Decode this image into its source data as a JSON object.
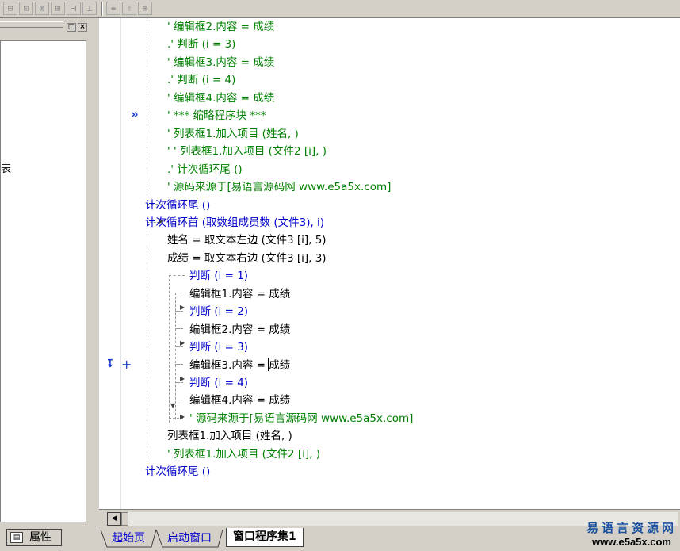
{
  "toolbar": {
    "buttons": [
      "align-left-icon",
      "align-center-icon",
      "align-top-icon",
      "align-middle-icon",
      "same-width-icon",
      "same-height-icon",
      "horizontal-space-icon",
      "vertical-space-icon",
      "center-icon"
    ],
    "glyphs": [
      "⊟",
      "⊡",
      "⊠",
      "⊞",
      "⊣",
      "⊥",
      "⇹",
      "⇳",
      "⊕"
    ]
  },
  "left_panel": {
    "truncated_text": "表",
    "properties_tab": "属性"
  },
  "editor": {
    "lines": [
      {
        "indent": 0,
        "text": "' 编辑框2.内容 = 成绩",
        "color": "green"
      },
      {
        "indent": 0,
        "text": ".' 判断 (i = 3)",
        "color": "green"
      },
      {
        "indent": 0,
        "text": "' 编辑框3.内容 = 成绩",
        "color": "green"
      },
      {
        "indent": 0,
        "text": ".' 判断 (i = 4)",
        "color": "green"
      },
      {
        "indent": 0,
        "text": "' 编辑框4.内容 = 成绩",
        "color": "green"
      },
      {
        "indent": 0,
        "text": "' *** 缩略程序块 ***",
        "color": "green"
      },
      {
        "indent": 0,
        "text": "' 列表框1.加入项目 (姓名, )",
        "color": "green"
      },
      {
        "indent": 0,
        "text": "' ' 列表框1.加入项目 (文件2 [i], )",
        "color": "green"
      },
      {
        "indent": 0,
        "text": ".' 计次循环尾 ()",
        "color": "green"
      },
      {
        "indent": 0,
        "text": "' 源码来源于[易语言源码网 www.e5a5x.com]",
        "color": "green"
      },
      {
        "indent": -1,
        "text": "计次循环尾 ()",
        "color": "blue"
      },
      {
        "indent": -1,
        "text": "计次循环首 (取数组成员数 (文件3), i)",
        "color": "blue"
      },
      {
        "indent": 0,
        "text": "姓名 = 取文本左边 (文件3 [i], 5)",
        "color": "dark"
      },
      {
        "indent": 0,
        "text": "成绩 = 取文本右边 (文件3 [i], 3)",
        "color": "dark"
      },
      {
        "indent": 1,
        "text": "判断 (i = 1)",
        "color": "blue"
      },
      {
        "indent": 1,
        "text": "编辑框1.内容 = 成绩",
        "color": "dark"
      },
      {
        "indent": 1,
        "text": "判断 (i = 2)",
        "color": "blue"
      },
      {
        "indent": 1,
        "text": "编辑框2.内容 = 成绩",
        "color": "dark"
      },
      {
        "indent": 1,
        "text": "判断 (i = 3)",
        "color": "blue"
      },
      {
        "indent": 1,
        "text": "编辑框3.内容 = 成绩",
        "color": "dark"
      },
      {
        "indent": 1,
        "text": "判断 (i = 4)",
        "color": "blue"
      },
      {
        "indent": 1,
        "text": "编辑框4.内容 = 成绩",
        "color": "dark"
      },
      {
        "indent": 1,
        "text": "' 源码来源于[易语言源码网 www.e5a5x.com]",
        "color": "green"
      },
      {
        "indent": 0,
        "text": "列表框1.加入项目 (姓名, )",
        "color": "dark"
      },
      {
        "indent": 0,
        "text": "' 列表框1.加入项目 (文件2 [i], )",
        "color": "green"
      },
      {
        "indent": -1,
        "text": "计次循环尾 ()",
        "color": "blue"
      }
    ],
    "gutter_markers": {
      "collapsed_block": "»",
      "current_line_arrow": "↧",
      "breakpoint_plus": "+"
    }
  },
  "tabs": [
    {
      "label": "起始页",
      "active": false
    },
    {
      "label": "启动窗口",
      "active": false
    },
    {
      "label": "窗口程序集1",
      "active": true
    }
  ],
  "watermark": {
    "line1": "易语言资源网",
    "line2": "www.e5a5x.com"
  },
  "colors": {
    "comment": "#008000",
    "keyword": "#0000cc",
    "function": "#8b0000",
    "text": "#000000"
  }
}
